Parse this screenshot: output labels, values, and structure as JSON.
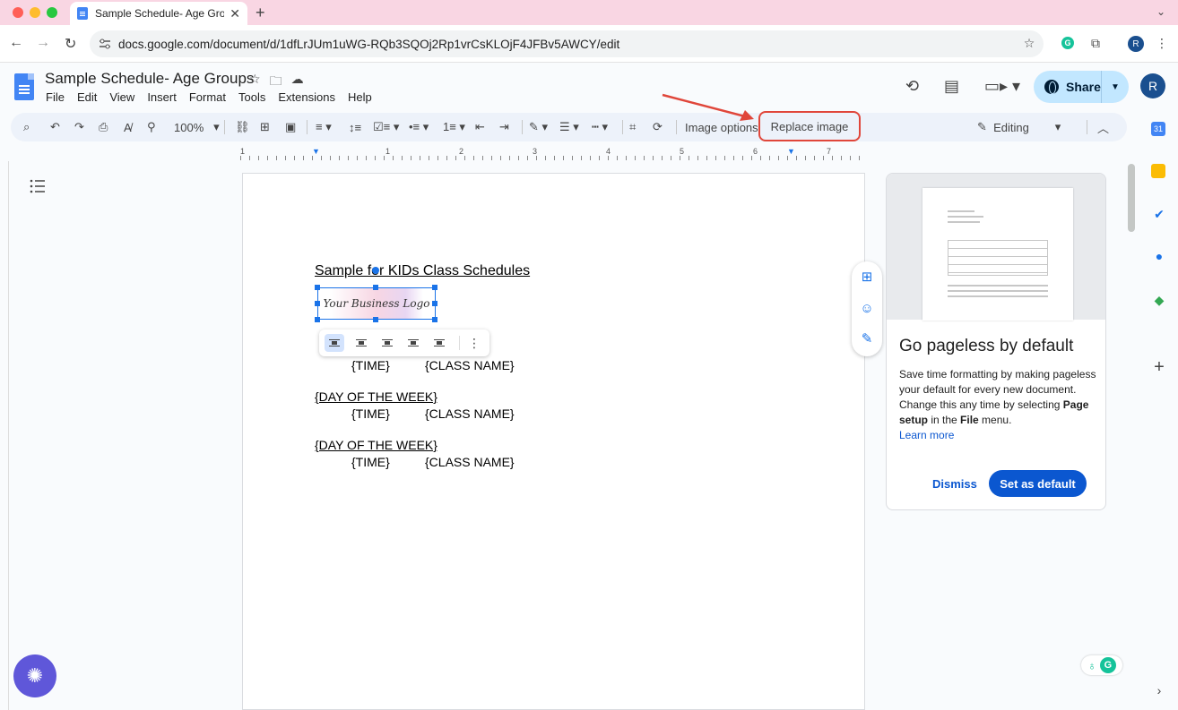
{
  "browser": {
    "tab_title": "Sample Schedule- Age Group",
    "url": "docs.google.com/document/d/1dfLrJUm1uWG-RQb3SQOj2Rp1vrCsKLOjF4JFBv5AWCY/edit",
    "profile_initial": "R"
  },
  "doc": {
    "title": "Sample Schedule- Age Groups",
    "menu": [
      "File",
      "Edit",
      "View",
      "Insert",
      "Format",
      "Tools",
      "Extensions",
      "Help"
    ],
    "share_label": "Share",
    "user_initial": "R"
  },
  "toolbar": {
    "zoom": "100%",
    "image_options_label": "Image options",
    "replace_image_label": "Replace image",
    "mode_label": "Editing"
  },
  "ruler": [
    "1",
    "1",
    "2",
    "3",
    "4",
    "5",
    "6",
    "7"
  ],
  "content": {
    "heading": "Sample for KIDs Class Schedules",
    "logo_text": "Your Business Logo",
    "row1": {
      "time": "{TIME}",
      "class": "{CLASS NAME}"
    },
    "day2": "{DAY OF THE WEEK}",
    "row2": {
      "time": "{TIME}",
      "class": "{CLASS NAME}"
    },
    "day3": "{DAY OF THE WEEK}",
    "row3": {
      "time": "{TIME}",
      "class": "{CLASS NAME}"
    }
  },
  "pageless_card": {
    "heading": "Go pageless by default",
    "body_1": "Save time formatting by making pageless your default for every new document. Change this any time by selecting ",
    "bold_1": "Page setup",
    "body_2": " in the ",
    "bold_2": "File",
    "body_3": " menu.",
    "learn_more": "Learn more",
    "dismiss": "Dismiss",
    "set_default": "Set as default"
  },
  "colors": {
    "accent": "#0b57d0",
    "highlight": "#e0463a",
    "tab_strip": "#f9d6e3"
  }
}
